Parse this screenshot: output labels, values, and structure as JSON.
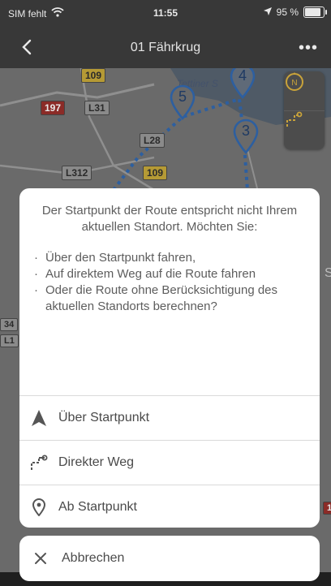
{
  "status_bar": {
    "carrier": "SIM fehlt",
    "time": "11:55",
    "battery": "95 %"
  },
  "nav": {
    "title": "01 Fährkrug",
    "more": "•••"
  },
  "map": {
    "labels": {
      "r109a": "109",
      "r197": "197",
      "l31": "L31",
      "l28": "L28",
      "l312": "L312",
      "r109b": "109",
      "place": "Tettiner S",
      "s_edge": "S",
      "r34": "34",
      "l1": "L1",
      "r1": "1"
    },
    "markers": [
      "4",
      "5",
      "3"
    ]
  },
  "sheet": {
    "message": "Der Startpunkt der Route entspricht nicht Ihrem aktuellen Standort. Möchten Sie:",
    "bullets": [
      "Über den Startpunkt fahren,",
      "Auf direktem Weg auf die Route fahren",
      "Oder die Route ohne Berücksichtigung des aktuellen Standorts berechnen?"
    ],
    "actions": [
      {
        "label": "Über Startpunkt",
        "icon": "navigation-arrow-icon"
      },
      {
        "label": "Direkter Weg",
        "icon": "route-direct-icon"
      },
      {
        "label": "Ab Startpunkt",
        "icon": "location-pin-icon"
      }
    ],
    "cancel": "Abbrechen"
  },
  "colors": {
    "route": "#2d5fa0",
    "overlay_bg": "#383838",
    "sheet_bg": "#ffffff",
    "text": "#5d5d5d"
  }
}
